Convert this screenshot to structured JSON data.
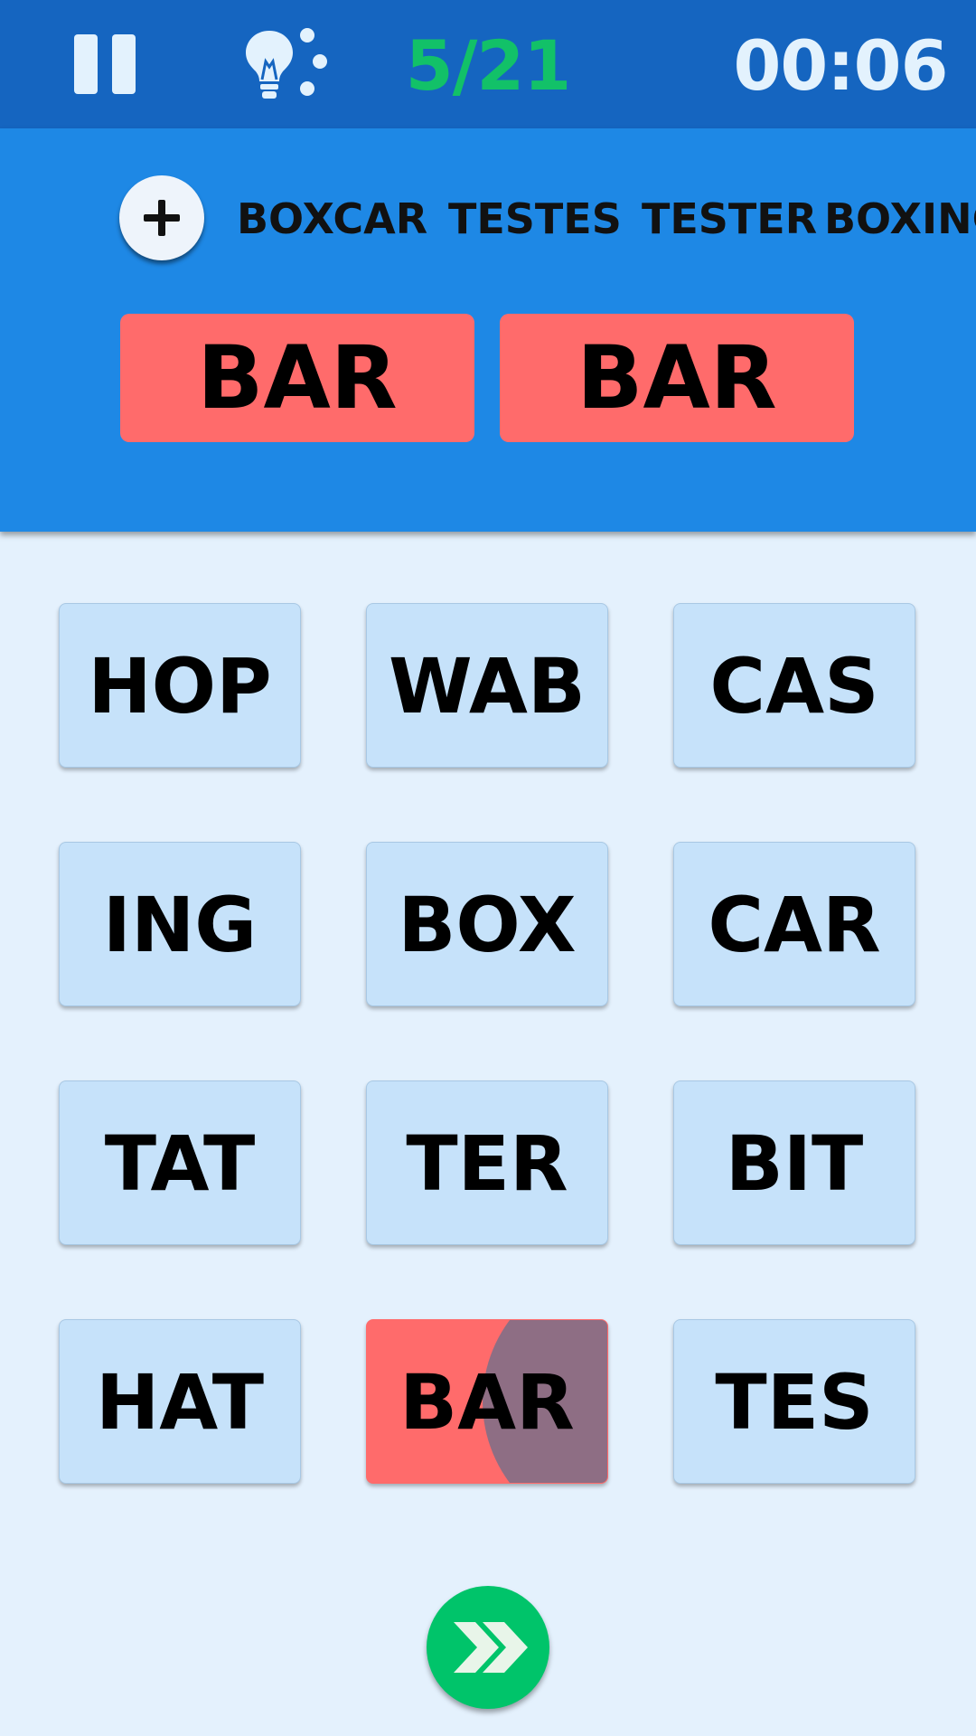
{
  "header": {
    "progress": "5/21",
    "timer": "00:06"
  },
  "found_words": [
    "BOXCAR",
    "TESTES",
    "TESTER",
    "BOXING"
  ],
  "selected_chips": [
    "BAR",
    "BAR"
  ],
  "tiles": [
    "HOP",
    "WAB",
    "CAS",
    "ING",
    "BOX",
    "CAR",
    "TAT",
    "TER",
    "BIT",
    "HAT",
    "BAR",
    "TES"
  ],
  "selected_tile": "BAR",
  "icons": {
    "pause": "pause-icon",
    "hint": "lightbulb-hint-icon",
    "add": "plus-icon",
    "next": "double-chevron-right-icon"
  },
  "colors": {
    "header_bg": "#1565c0",
    "panel_bg": "#1e88e5",
    "progress": "#12c168",
    "tile": "#c6e2fa",
    "selected": "#ff6b6b",
    "next_button": "#00c46a"
  }
}
